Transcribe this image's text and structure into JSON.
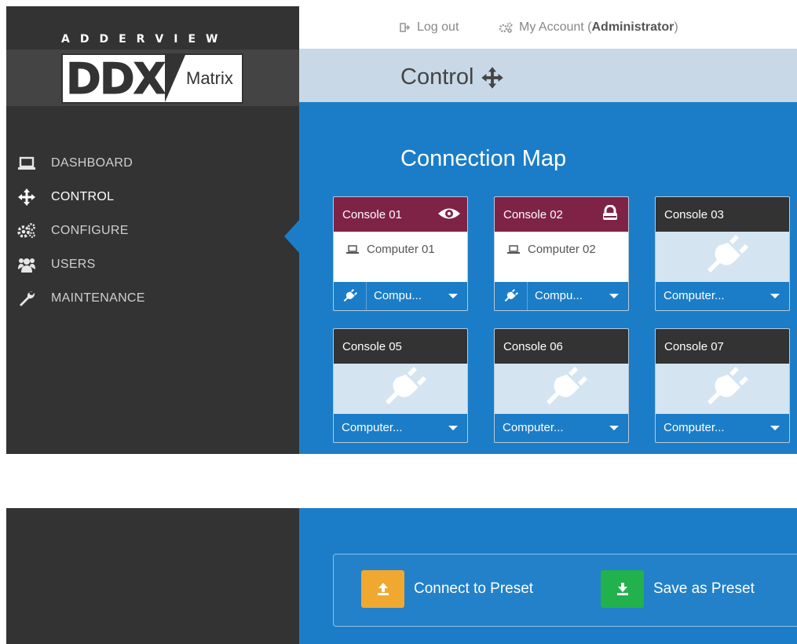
{
  "header": {
    "logout_label": "Log out",
    "account_label": "My Account",
    "account_role": "Administrator",
    "account_paren_open": "(",
    "account_paren_close": ")"
  },
  "brand": {
    "wordmark": "ADDERVIEW",
    "logo_main": "DDX",
    "logo_sub": "Matrix"
  },
  "sidebar": {
    "items": [
      {
        "label": "DASHBOARD",
        "icon": "laptop-icon",
        "active": false
      },
      {
        "label": "CONTROL",
        "icon": "move-arrows-icon",
        "active": true
      },
      {
        "label": "CONFIGURE",
        "icon": "cogs-icon",
        "active": false
      },
      {
        "label": "USERS",
        "icon": "users-icon",
        "active": false
      },
      {
        "label": "MAINTENANCE",
        "icon": "wrench-icon",
        "active": false
      }
    ]
  },
  "page": {
    "title": "Control",
    "title_icon": "move-arrows-icon"
  },
  "connection_map": {
    "title": "Connection Map",
    "consoles": [
      {
        "name": "Console 01",
        "status": "viewing",
        "status_icon": "eye-icon",
        "computer": "Computer 01",
        "selected": "Compu..."
      },
      {
        "name": "Console 02",
        "status": "viewing",
        "status_icon": "lock-icon",
        "computer": "Computer 02",
        "selected": "Compu..."
      },
      {
        "name": "Console 03",
        "status": "disconnected",
        "computer": "",
        "selected": "Computer..."
      },
      {
        "name": "Console 05",
        "status": "disconnected",
        "computer": "",
        "selected": "Computer..."
      },
      {
        "name": "Console 06",
        "status": "disconnected",
        "computer": "",
        "selected": "Computer..."
      },
      {
        "name": "Console 07",
        "status": "disconnected",
        "computer": "",
        "selected": "Computer..."
      }
    ]
  },
  "presets": {
    "connect_label": "Connect to Preset",
    "save_label": "Save as Preset",
    "connect_color": "#f0a830",
    "save_color": "#22b14c"
  },
  "colors": {
    "sidebar_bg": "#333333",
    "main_blue": "#1b7dc7",
    "header_strip": "#c8d8e6",
    "viewing_header": "#7e2346",
    "empty_body": "#d4e4f1"
  }
}
